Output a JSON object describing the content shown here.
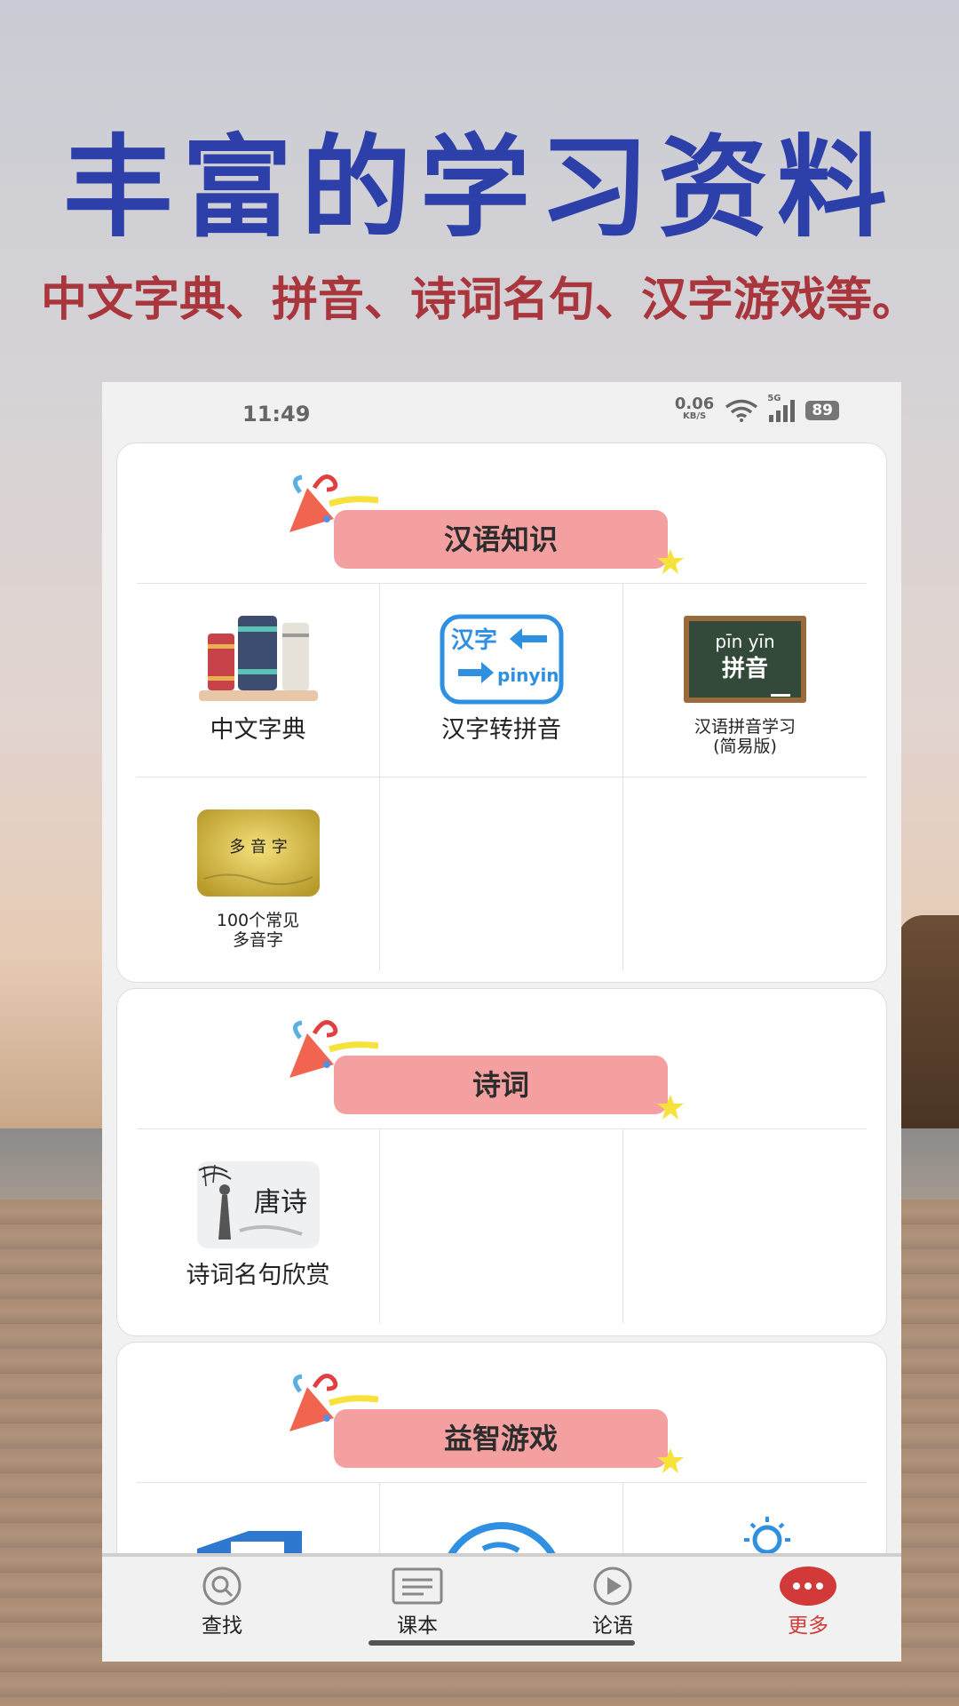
{
  "promo": {
    "title": "丰富的学习资料",
    "subtitle": "中文字典、拼音、诗词名句、汉字游戏等。"
  },
  "status_bar": {
    "time": "11:49",
    "net_speed": "0.06",
    "net_unit": "KB/S",
    "network_type": "5G",
    "battery": "89"
  },
  "sections": [
    {
      "title": "汉语知识",
      "items": [
        {
          "label": "中文字典",
          "icon": "books-icon"
        },
        {
          "label": "汉字转拼音",
          "icon": "hanzi-pinyin-icon",
          "icon_text_top": "汉字",
          "icon_text_bottom": "pinyin"
        },
        {
          "label_line1": "汉语拼音学习",
          "label_line2": "(简易版)",
          "icon": "blackboard-icon",
          "icon_text_top": "pīn yīn",
          "icon_text_bottom": "拼音"
        },
        {
          "label_line1": "100个常见",
          "label_line2": "多音字",
          "icon": "scroll-icon",
          "icon_text": "多 音 字"
        }
      ]
    },
    {
      "title": "诗词",
      "items": [
        {
          "label": "诗词名句欣赏",
          "icon": "tang-poem-icon",
          "icon_text": "唐诗"
        }
      ]
    },
    {
      "title": "益智游戏",
      "items": []
    }
  ],
  "bottom_nav": [
    {
      "label": "查找",
      "icon": "search-icon",
      "active": false
    },
    {
      "label": "课本",
      "icon": "textbook-icon",
      "active": false
    },
    {
      "label": "论语",
      "icon": "play-icon",
      "active": false
    },
    {
      "label": "更多",
      "icon": "more-icon",
      "active": true
    }
  ],
  "colors": {
    "title_blue": "#2d3fa8",
    "subtitle_red": "#a8363c",
    "ribbon_pink": "#f4a0a0",
    "active_red": "#d23a3a"
  }
}
